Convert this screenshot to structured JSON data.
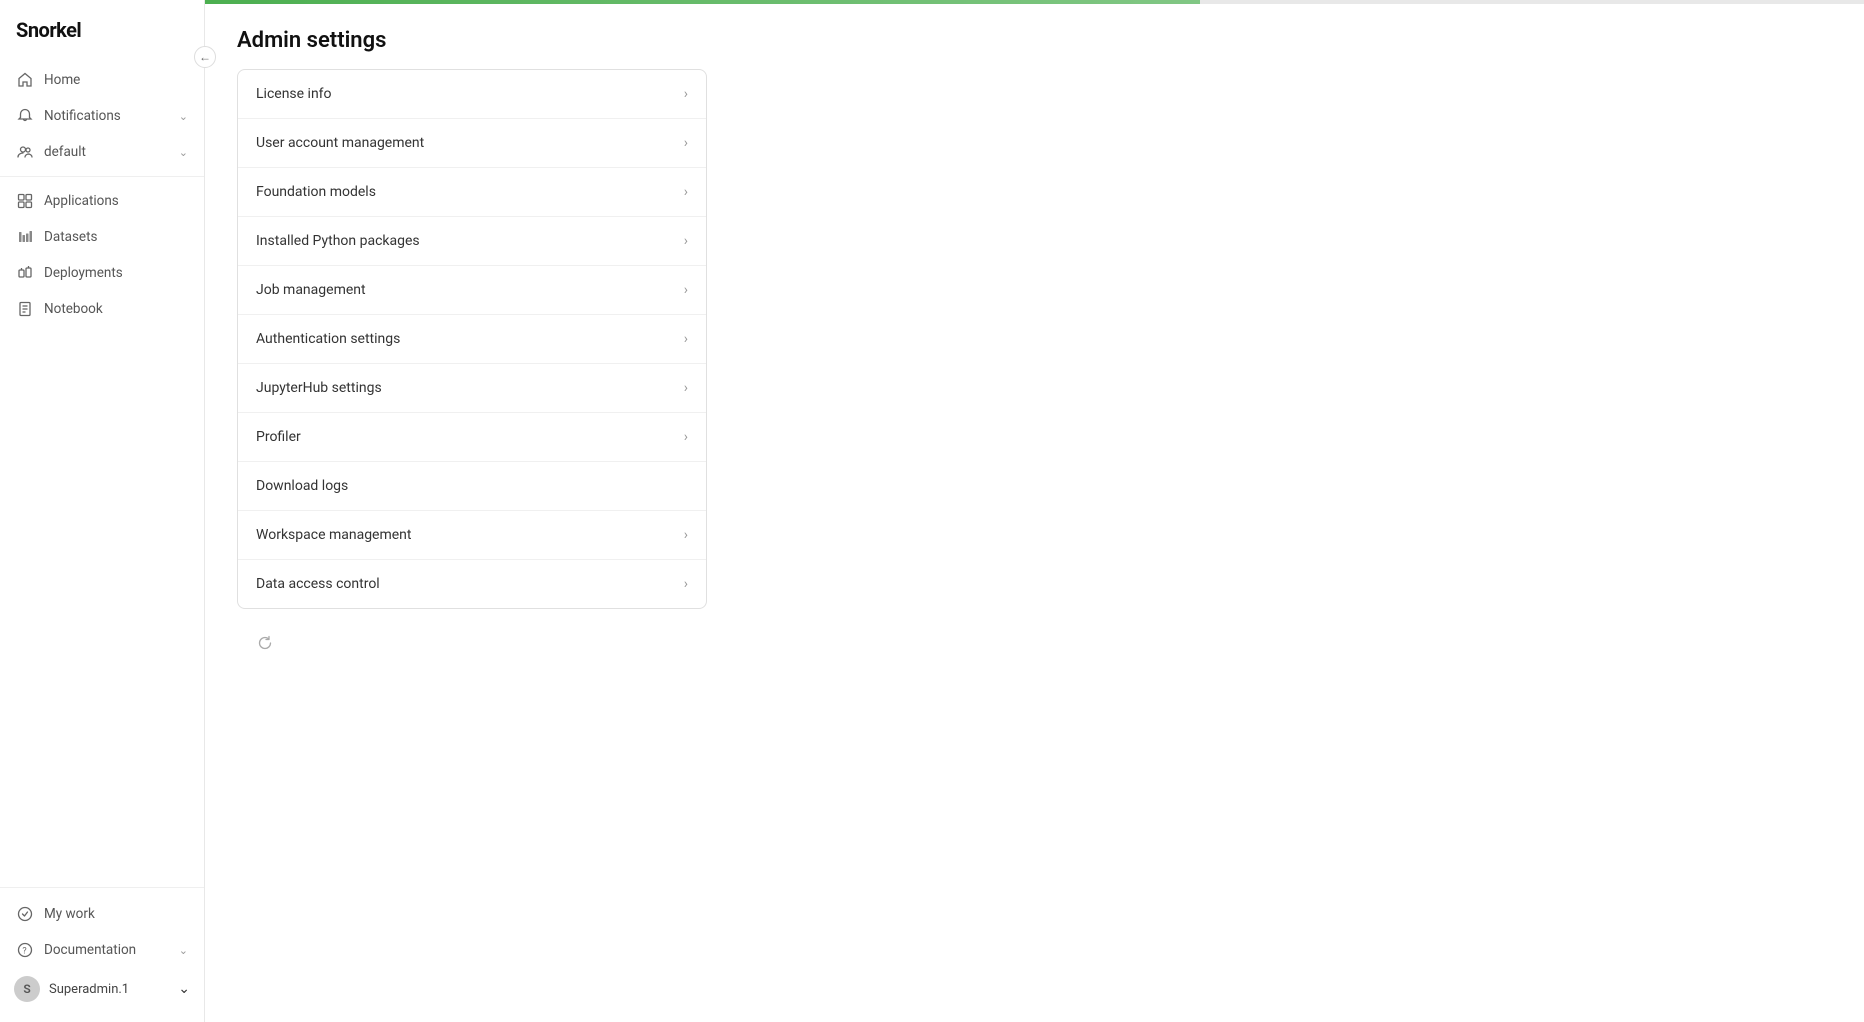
{
  "app": {
    "logo": "Snorkel",
    "collapse_arrow": "←"
  },
  "sidebar": {
    "nav_items": [
      {
        "id": "home",
        "label": "Home",
        "icon": "home-icon",
        "has_chevron": false
      },
      {
        "id": "notifications",
        "label": "Notifications",
        "icon": "bell-icon",
        "has_chevron": true
      },
      {
        "id": "default",
        "label": "default",
        "icon": "user-group-icon",
        "has_chevron": true
      }
    ],
    "nav_items2": [
      {
        "id": "applications",
        "label": "Applications",
        "icon": "applications-icon",
        "has_chevron": false
      },
      {
        "id": "datasets",
        "label": "Datasets",
        "icon": "datasets-icon",
        "has_chevron": false
      },
      {
        "id": "deployments",
        "label": "Deployments",
        "icon": "deployments-icon",
        "has_chevron": false
      },
      {
        "id": "notebook",
        "label": "Notebook",
        "icon": "notebook-icon",
        "has_chevron": false
      }
    ],
    "bottom_items": [
      {
        "id": "my-work",
        "label": "My work",
        "icon": "mywork-icon",
        "has_chevron": false
      },
      {
        "id": "documentation",
        "label": "Documentation",
        "icon": "docs-icon",
        "has_chevron": true
      }
    ],
    "user": {
      "avatar_initial": "S",
      "name": "Superadmin.1"
    }
  },
  "page": {
    "title": "Admin settings"
  },
  "settings_items": [
    {
      "id": "license-info",
      "label": "License info",
      "has_chevron": true
    },
    {
      "id": "user-account-management",
      "label": "User account management",
      "has_chevron": true
    },
    {
      "id": "foundation-models",
      "label": "Foundation models",
      "has_chevron": true
    },
    {
      "id": "installed-python-packages",
      "label": "Installed Python packages",
      "has_chevron": true
    },
    {
      "id": "job-management",
      "label": "Job management",
      "has_chevron": true
    },
    {
      "id": "authentication-settings",
      "label": "Authentication settings",
      "has_chevron": true
    },
    {
      "id": "jupyterhub-settings",
      "label": "JupyterHub settings",
      "has_chevron": true
    },
    {
      "id": "profiler",
      "label": "Profiler",
      "has_chevron": true
    },
    {
      "id": "download-logs",
      "label": "Download logs",
      "has_chevron": false
    },
    {
      "id": "workspace-management",
      "label": "Workspace management",
      "has_chevron": true
    },
    {
      "id": "data-access-control",
      "label": "Data access control",
      "has_chevron": true
    }
  ]
}
